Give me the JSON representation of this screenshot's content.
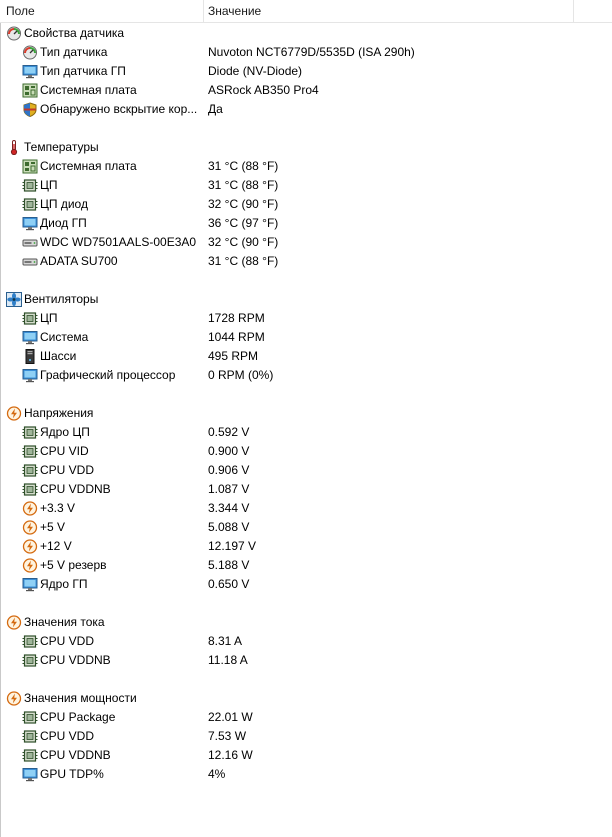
{
  "header": {
    "field": "Поле",
    "value": "Значение"
  },
  "groups": [
    {
      "label": "Свойства датчика",
      "icon": "sensor-gauge-icon",
      "items": [
        {
          "label": "Тип датчика",
          "value": "Nuvoton NCT6779D/5535D  (ISA 290h)",
          "icon": "sensor-gauge-icon"
        },
        {
          "label": "Тип датчика ГП",
          "value": "Diode  (NV-Diode)",
          "icon": "gpu-monitor-icon"
        },
        {
          "label": "Системная плата",
          "value": "ASRock AB350 Pro4",
          "icon": "motherboard-icon"
        },
        {
          "label": "Обнаружено вскрытие кор...",
          "value": "Да",
          "icon": "security-shield-icon"
        }
      ]
    },
    {
      "label": "Температуры",
      "icon": "thermometer-icon",
      "items": [
        {
          "label": "Системная плата",
          "value": "31 °C  (88 °F)",
          "icon": "motherboard-icon"
        },
        {
          "label": "ЦП",
          "value": "31 °C  (88 °F)",
          "icon": "cpu-chip-icon"
        },
        {
          "label": "ЦП диод",
          "value": "32 °C  (90 °F)",
          "icon": "cpu-chip-icon"
        },
        {
          "label": "Диод ГП",
          "value": "36 °C  (97 °F)",
          "icon": "gpu-monitor-icon"
        },
        {
          "label": "WDC WD7501AALS-00E3A0",
          "value": "32 °C  (90 °F)",
          "icon": "hard-drive-icon"
        },
        {
          "label": "ADATA SU700",
          "value": "31 °C  (88 °F)",
          "icon": "hard-drive-icon"
        }
      ]
    },
    {
      "label": "Вентиляторы",
      "icon": "fan-icon",
      "items": [
        {
          "label": "ЦП",
          "value": "1728 RPM",
          "icon": "cpu-chip-icon"
        },
        {
          "label": "Система",
          "value": "1044 RPM",
          "icon": "system-monitor-icon"
        },
        {
          "label": "Шасси",
          "value": "495 RPM",
          "icon": "pc-chassis-icon"
        },
        {
          "label": "Графический процессор",
          "value": "0 RPM  (0%)",
          "icon": "gpu-monitor-icon"
        }
      ]
    },
    {
      "label": "Напряжения",
      "icon": "voltage-bolt-icon",
      "items": [
        {
          "label": "Ядро ЦП",
          "value": "0.592 V",
          "icon": "cpu-chip-icon"
        },
        {
          "label": "CPU VID",
          "value": "0.900 V",
          "icon": "cpu-chip-icon"
        },
        {
          "label": "CPU VDD",
          "value": "0.906 V",
          "icon": "cpu-chip-icon"
        },
        {
          "label": "CPU VDDNB",
          "value": "1.087 V",
          "icon": "cpu-chip-icon"
        },
        {
          "label": "+3.3 V",
          "value": "3.344 V",
          "icon": "voltage-bolt-icon"
        },
        {
          "label": "+5 V",
          "value": "5.088 V",
          "icon": "voltage-bolt-icon"
        },
        {
          "label": "+12 V",
          "value": "12.197 V",
          "icon": "voltage-bolt-icon"
        },
        {
          "label": "+5 V резерв",
          "value": "5.188 V",
          "icon": "voltage-bolt-icon"
        },
        {
          "label": "Ядро ГП",
          "value": "0.650 V",
          "icon": "gpu-monitor-icon"
        }
      ]
    },
    {
      "label": "Значения тока",
      "icon": "voltage-bolt-icon",
      "items": [
        {
          "label": "CPU VDD",
          "value": "8.31 A",
          "icon": "cpu-chip-icon"
        },
        {
          "label": "CPU VDDNB",
          "value": "11.18 A",
          "icon": "cpu-chip-icon"
        }
      ]
    },
    {
      "label": "Значения мощности",
      "icon": "voltage-bolt-icon",
      "items": [
        {
          "label": "CPU Package",
          "value": "22.01 W",
          "icon": "cpu-chip-icon"
        },
        {
          "label": "CPU VDD",
          "value": "7.53 W",
          "icon": "cpu-chip-icon"
        },
        {
          "label": "CPU VDDNB",
          "value": "12.16 W",
          "icon": "cpu-chip-icon"
        },
        {
          "label": "GPU TDP%",
          "value": "4%",
          "icon": "gpu-monitor-icon"
        }
      ]
    }
  ]
}
